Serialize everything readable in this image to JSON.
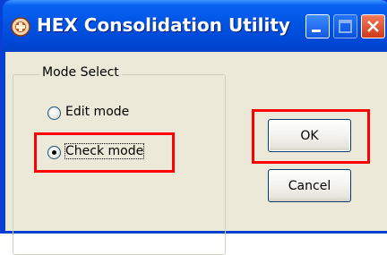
{
  "window": {
    "title": "HEX Consolidation Utility",
    "icon": "app-gear-icon",
    "controls": [
      "minimize-icon",
      "maximize-icon",
      "close-icon"
    ]
  },
  "group": {
    "label": "Mode Select",
    "options": [
      {
        "label": "Edit mode",
        "selected": false
      },
      {
        "label": "Check mode",
        "selected": true
      }
    ]
  },
  "buttons": {
    "ok": "OK",
    "cancel": "Cancel"
  },
  "highlight_color": "#ff0000",
  "colors": {
    "titlebar": "#0054e3",
    "dialog_bg": "#ece9d8"
  }
}
